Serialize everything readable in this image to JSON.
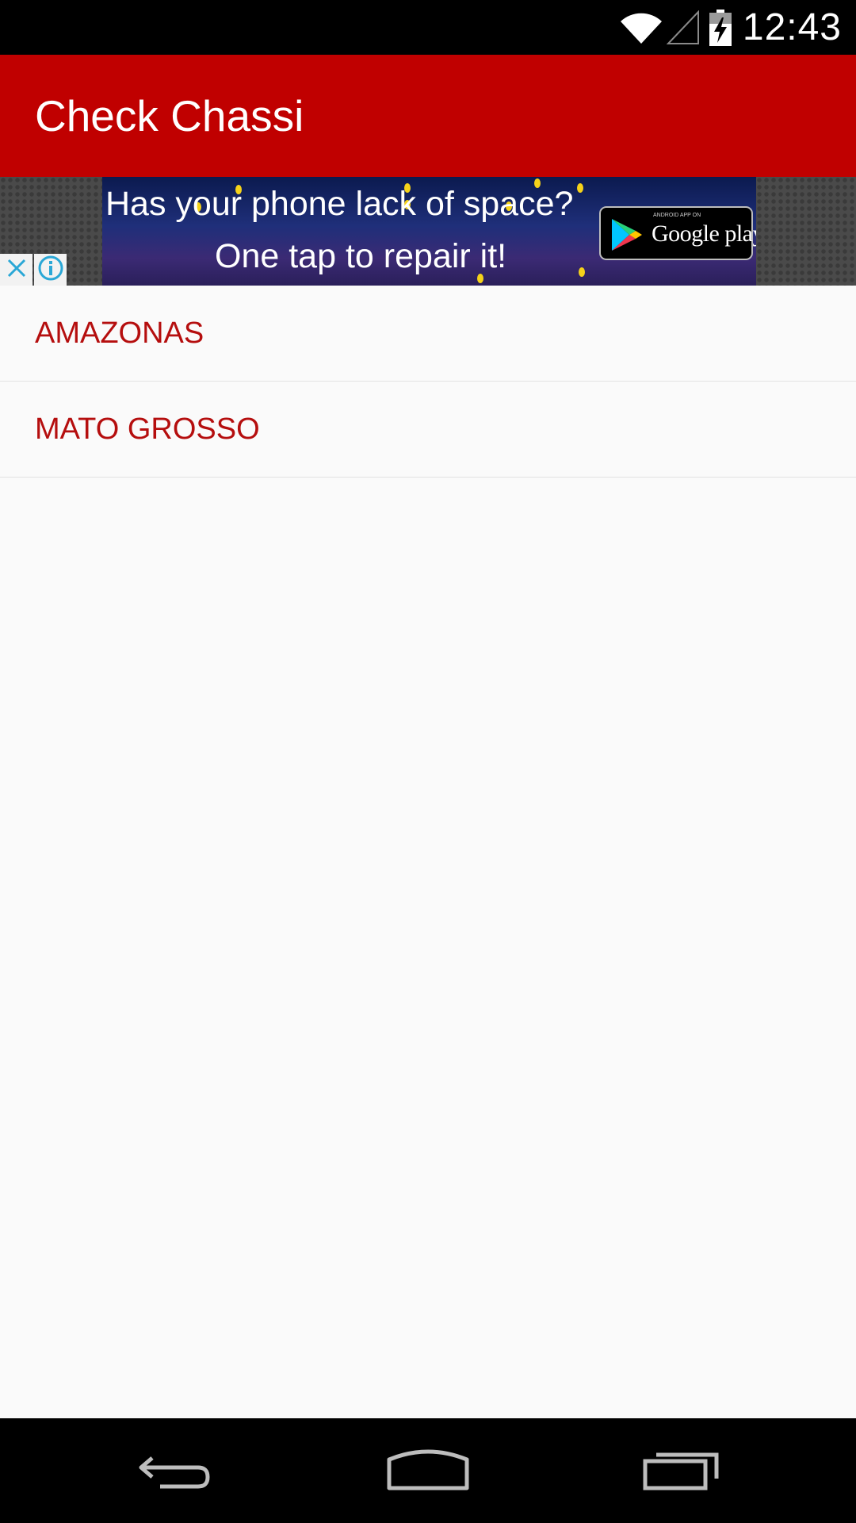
{
  "status_bar": {
    "time": "12:43",
    "icons": [
      "wifi-icon",
      "cell-signal-icon",
      "battery-charging-icon"
    ]
  },
  "app_bar": {
    "title": "Check Chassi",
    "color": "#c00000"
  },
  "ad": {
    "line1": "Has your phone lack of space?",
    "line2": "One tap to repair it!",
    "badge_small": "ANDROID APP ON",
    "badge_text": "Google play",
    "close_icon": "close-icon",
    "info_icon": "info-icon"
  },
  "list": {
    "items": [
      {
        "label": "AMAZONAS"
      },
      {
        "label": "MATO GROSSO"
      }
    ],
    "text_color": "#b50e0e"
  },
  "nav_bar": {
    "buttons": [
      "back-icon",
      "home-icon",
      "recent-apps-icon"
    ]
  }
}
